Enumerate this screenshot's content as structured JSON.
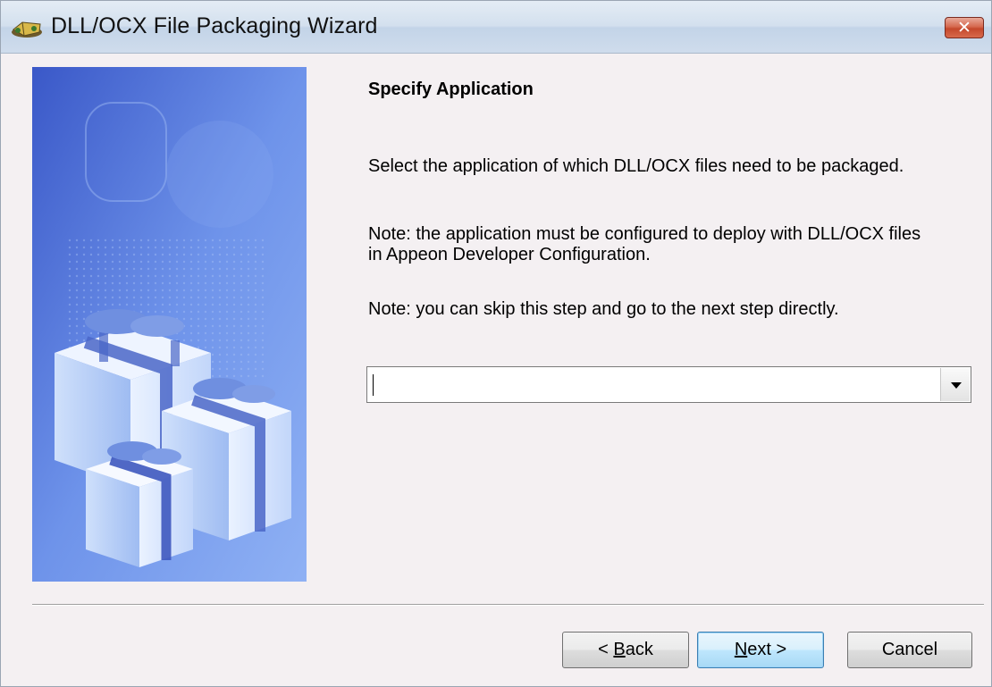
{
  "window": {
    "title": "DLL/OCX File Packaging Wizard",
    "close_label": "✕",
    "icon": "package-icon"
  },
  "content": {
    "heading": "Specify Application",
    "instruction": "Select the application of which DLL/OCX files need to be packaged.",
    "note_config_line1": "Note: the application must be configured to deploy with DLL/OCX files",
    "note_config_line2": "in Appeon Developer Configuration.",
    "note_skip": "Note: you can skip this step and go to the next step directly."
  },
  "application_select": {
    "value": "",
    "icon": "chevron-down-icon"
  },
  "buttons": {
    "back_prefix": "< ",
    "back_accel": "B",
    "back_rest": "ack",
    "next_accel": "N",
    "next_rest": "ext >",
    "cancel": "Cancel"
  },
  "colors": {
    "titlebar": "#d3e0ee",
    "close": "#c4482c",
    "default_button_border": "#3c7fb1",
    "side_image_blue": "#5f86e0"
  }
}
